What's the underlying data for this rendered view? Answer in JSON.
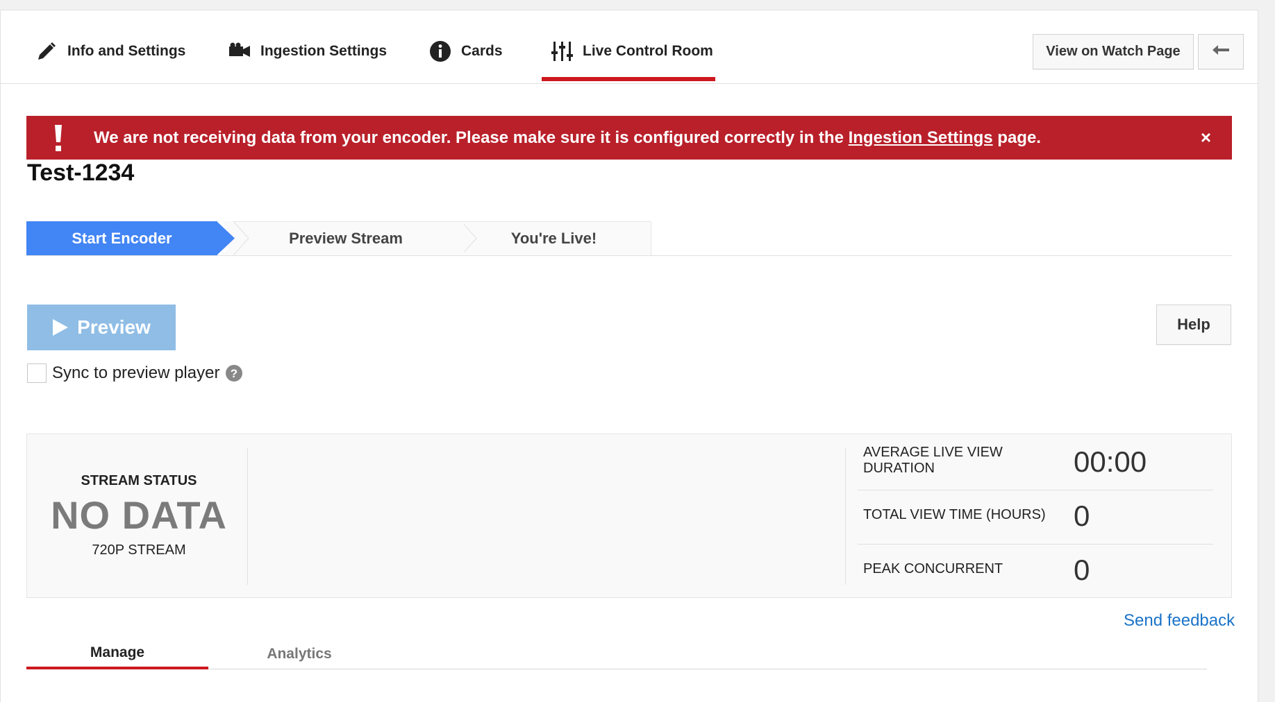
{
  "nav": {
    "tabs": [
      {
        "label": "Info and Settings",
        "icon": "pencil-icon"
      },
      {
        "label": "Ingestion Settings",
        "icon": "camera-icon"
      },
      {
        "label": "Cards",
        "icon": "info-icon"
      },
      {
        "label": "Live Control Room",
        "icon": "sliders-icon"
      }
    ],
    "active_tab": "Live Control Room",
    "view_on_watch_page": "View on Watch Page",
    "back_icon": "back-arrow-icon"
  },
  "alert": {
    "message_prefix": "We are not receiving data from your encoder. Please make sure it is configured correctly in the ",
    "link_text": "Ingestion Settings",
    "message_suffix": " page.",
    "close_glyph": "×",
    "icon": "exclamation-icon",
    "color": "#b9202a"
  },
  "title": "Test-1234",
  "steps": [
    {
      "label": "Start Encoder",
      "active": true
    },
    {
      "label": "Preview Stream",
      "active": false
    },
    {
      "label": "You're Live!",
      "active": false
    }
  ],
  "preview_button": "Preview",
  "help_button": "Help",
  "sync": {
    "label": "Sync to preview player",
    "checked": false
  },
  "stream": {
    "status_label": "STREAM STATUS",
    "status_value": "NO DATA",
    "resolution": "720P STREAM"
  },
  "metrics": [
    {
      "label_line1": "AVERAGE LIVE VIEW",
      "label_line2": "DURATION",
      "value": "00:00"
    },
    {
      "label_line1": "TOTAL VIEW TIME (HOURS)",
      "label_line2": "",
      "value": "0"
    },
    {
      "label_line1": "PEAK CONCURRENT",
      "label_line2": "",
      "value": "0"
    }
  ],
  "send_feedback": "Send feedback",
  "bottom_tabs": [
    {
      "label": "Manage",
      "active": true
    },
    {
      "label": "Analytics",
      "active": false
    }
  ],
  "colors": {
    "accent_red": "#cc181e",
    "step_blue": "#4285f4",
    "preview_disabled_blue": "#8fbde5",
    "link_blue": "#1a73c8"
  }
}
